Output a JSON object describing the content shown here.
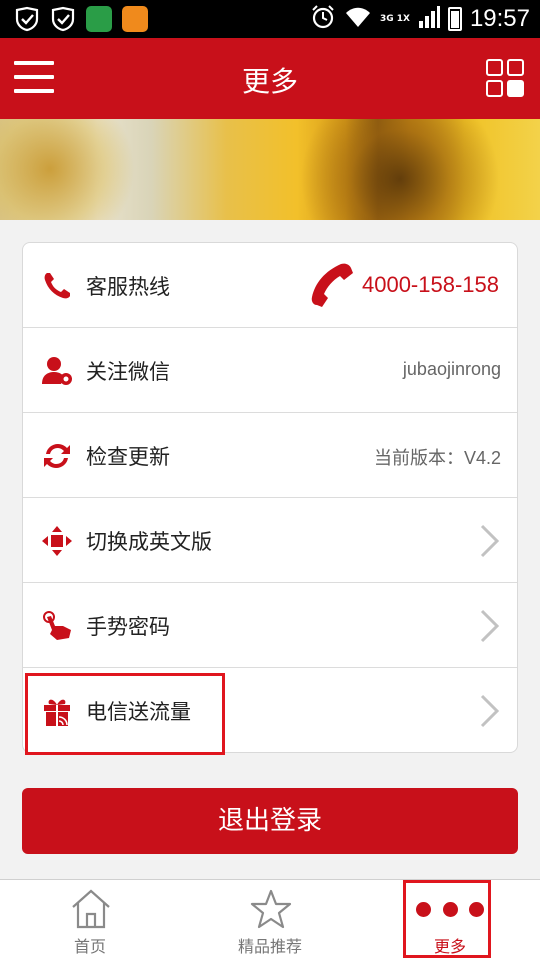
{
  "status_bar": {
    "network": "3G 1X",
    "time": "19:57",
    "icons": [
      "shield-check-icon",
      "shield-check-icon",
      "huawei-app-icon",
      "uc-browser-icon",
      "alarm-icon",
      "wifi-icon",
      "signal-icon",
      "battery-icon"
    ]
  },
  "header": {
    "title": "更多",
    "menu_icon": "hamburger-icon",
    "grid_icon": "grid-apps-icon"
  },
  "settings": {
    "items": [
      {
        "label": "客服热线",
        "value": "4000-158-158",
        "icon": "phone-icon",
        "type": "phone"
      },
      {
        "label": "关注微信",
        "value": "jubaojinrong",
        "icon": "user-settings-icon",
        "type": "value"
      },
      {
        "label": "检查更新",
        "value": "当前版本：V4.2",
        "icon": "refresh-icon",
        "type": "value"
      },
      {
        "label": "切换成英文版",
        "icon": "move-arrows-icon",
        "type": "chevron"
      },
      {
        "label": "手势密码",
        "icon": "hand-gesture-icon",
        "type": "chevron"
      },
      {
        "label": "电信送流量",
        "icon": "gift-icon",
        "type": "chevron"
      }
    ]
  },
  "logout_label": "退出登录",
  "tabs": [
    {
      "label": "首页",
      "icon": "home-icon",
      "active": false
    },
    {
      "label": "精品推荐",
      "icon": "star-icon",
      "active": false
    },
    {
      "label": "更多",
      "icon": "more-dots-icon",
      "active": true
    }
  ],
  "colors": {
    "brand_red": "#c8101a",
    "highlight_red": "#e0161e"
  }
}
